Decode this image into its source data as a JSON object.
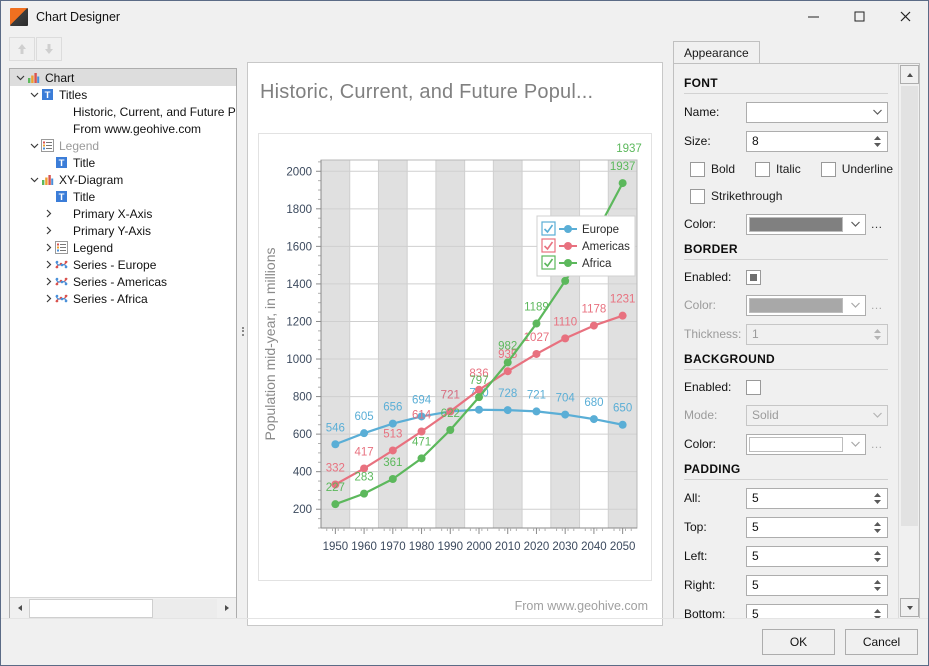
{
  "window": {
    "title": "Chart Designer",
    "app_icon": "chart-app-icon",
    "minimize": "─",
    "maximize": "☐",
    "close": "✕"
  },
  "toolbar": {
    "move_up": "move-up-arrow",
    "move_down": "move-down-arrow"
  },
  "tree": {
    "items": [
      {
        "label": "Chart",
        "indent": 0,
        "chevron": "down",
        "icon": "chart-icon",
        "selected": true,
        "dim": false
      },
      {
        "label": "Titles",
        "indent": 1,
        "chevron": "down",
        "icon": "text-icon",
        "selected": false,
        "dim": false
      },
      {
        "label": "Historic, Current, and Future Popu",
        "indent": 2,
        "chevron": "none",
        "icon": "none",
        "selected": false,
        "dim": false
      },
      {
        "label": "From www.geohive.com",
        "indent": 2,
        "chevron": "none",
        "icon": "none",
        "selected": false,
        "dim": false
      },
      {
        "label": "Legend",
        "indent": 1,
        "chevron": "down",
        "icon": "legend-icon",
        "selected": false,
        "dim": true
      },
      {
        "label": "Title",
        "indent": 2,
        "chevron": "none",
        "icon": "text-icon",
        "selected": false,
        "dim": false
      },
      {
        "label": "XY-Diagram",
        "indent": 1,
        "chevron": "down",
        "icon": "chart-icon",
        "selected": false,
        "dim": false
      },
      {
        "label": "Title",
        "indent": 2,
        "chevron": "none",
        "icon": "text-icon",
        "selected": false,
        "dim": false
      },
      {
        "label": "Primary X-Axis",
        "indent": 2,
        "chevron": "right",
        "icon": "none",
        "selected": false,
        "dim": false
      },
      {
        "label": "Primary Y-Axis",
        "indent": 2,
        "chevron": "right",
        "icon": "none",
        "selected": false,
        "dim": false
      },
      {
        "label": "Legend",
        "indent": 2,
        "chevron": "right",
        "icon": "legend-icon",
        "selected": false,
        "dim": false
      },
      {
        "label": "Series - Europe",
        "indent": 2,
        "chevron": "right",
        "icon": "series-icon",
        "selected": false,
        "dim": false
      },
      {
        "label": "Series - Americas",
        "indent": 2,
        "chevron": "right",
        "icon": "series-icon",
        "selected": false,
        "dim": false
      },
      {
        "label": "Series - Africa",
        "indent": 2,
        "chevron": "right",
        "icon": "series-icon",
        "selected": false,
        "dim": false
      }
    ],
    "hscroll_left": "scroll-left-arrow",
    "hscroll_right": "scroll-right-arrow"
  },
  "chart_data": {
    "type": "line",
    "title": "Historic, Current, and Future Popul...",
    "footer": "From www.geohive.com",
    "xlabel": "",
    "ylabel": "Population mid-year, in millions",
    "categories": [
      1950,
      1960,
      1970,
      1980,
      1990,
      2000,
      2010,
      2020,
      2030,
      2040,
      2050
    ],
    "ylim": [
      100,
      2060
    ],
    "yticks": [
      200,
      400,
      600,
      800,
      1000,
      1200,
      1400,
      1600,
      1800,
      2000
    ],
    "grid": true,
    "legend_position": "top-right",
    "series": [
      {
        "name": "Europe",
        "color": "#5aaed6",
        "checked": true,
        "values": [
          546,
          605,
          656,
          694,
          721,
          730,
          728,
          721,
          704,
          680,
          650
        ]
      },
      {
        "name": "Americas",
        "color": "#e8717f",
        "checked": true,
        "values": [
          332,
          417,
          513,
          614,
          721,
          836,
          935,
          1027,
          1110,
          1178,
          1231
        ]
      },
      {
        "name": "Africa",
        "color": "#5cb85c",
        "checked": true,
        "values": [
          227,
          283,
          361,
          471,
          622,
          797,
          982,
          1189,
          1416,
          1649,
          1937
        ]
      }
    ],
    "top_label": "1937"
  },
  "panel": {
    "tab": "Appearance",
    "sections": {
      "font": {
        "heading": "FONT",
        "name_label": "Name:",
        "name_value": "",
        "size_label": "Size:",
        "size_value": "8",
        "bold_label": "Bold",
        "bold_checked": false,
        "italic_label": "Italic",
        "italic_checked": false,
        "underline_label": "Underline",
        "underline_checked": false,
        "strikethrough_label": "Strikethrough",
        "strikethrough_checked": false,
        "color_label": "Color:",
        "color_value": "#808080",
        "ellipsis": "…"
      },
      "border": {
        "heading": "BORDER",
        "enabled_label": "Enabled:",
        "enabled_checked": true,
        "color_label": "Color:",
        "color_value": "#a8a8a8",
        "thickness_label": "Thickness:",
        "thickness_value": "1",
        "ellipsis": "…"
      },
      "background": {
        "heading": "BACKGROUND",
        "enabled_label": "Enabled:",
        "enabled_checked": false,
        "mode_label": "Mode:",
        "mode_value": "Solid",
        "color_label": "Color:",
        "color_value": "#ffffff",
        "ellipsis": "…"
      },
      "padding": {
        "heading": "PADDING",
        "all_label": "All:",
        "all_value": "5",
        "top_label": "Top:",
        "top_value": "5",
        "left_label": "Left:",
        "left_value": "5",
        "right_label": "Right:",
        "right_value": "5",
        "bottom_label": "Bottom:",
        "bottom_value": "5"
      }
    },
    "scroll_up": "scroll-up-arrow",
    "scroll_down": "scroll-down-arrow"
  },
  "footer": {
    "ok": "OK",
    "cancel": "Cancel"
  }
}
